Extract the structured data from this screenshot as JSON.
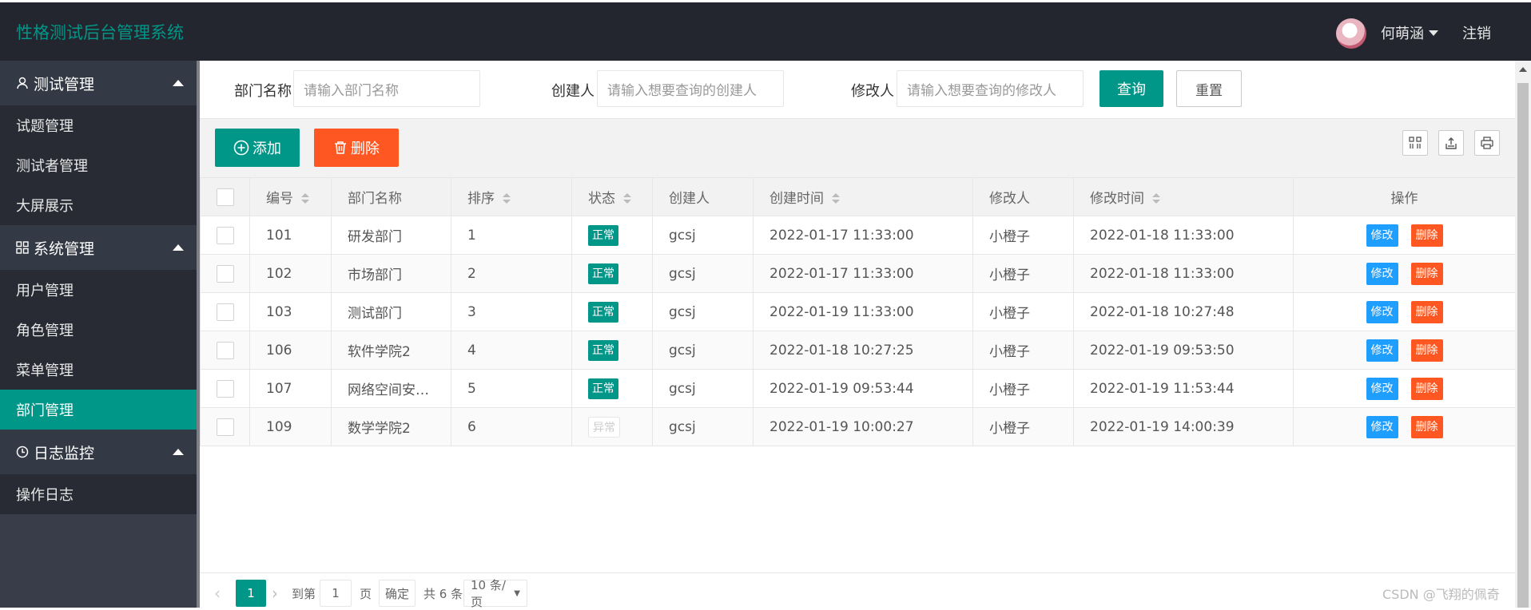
{
  "header": {
    "title": "性格测试后台管理系统",
    "username": "何萌涵",
    "logout": "注销"
  },
  "sidebar": {
    "groups": [
      {
        "label": "测试管理",
        "items": [
          "试题管理",
          "测试者管理",
          "大屏展示"
        ]
      },
      {
        "label": "系统管理",
        "items": [
          "用户管理",
          "角色管理",
          "菜单管理",
          "部门管理"
        ]
      },
      {
        "label": "日志监控",
        "items": [
          "操作日志"
        ]
      }
    ],
    "active_item": "部门管理"
  },
  "search": {
    "dept_label": "部门名称",
    "dept_placeholder": "请输入部门名称",
    "creator_label": "创建人",
    "creator_placeholder": "请输入想要查询的创建人",
    "modifier_label": "修改人",
    "modifier_placeholder": "请输入想要查询的修改人",
    "query": "查询",
    "reset": "重置"
  },
  "toolbar": {
    "add": "添加",
    "delete": "删除"
  },
  "table": {
    "headers": [
      "编号",
      "部门名称",
      "排序",
      "状态",
      "创建人",
      "创建时间",
      "修改人",
      "修改时间",
      "操作"
    ],
    "rows": [
      {
        "id": "101",
        "name": "研发部门",
        "order": "1",
        "status": "正常",
        "creator": "gcsj",
        "created": "2022-01-17 11:33:00",
        "modifier": "小橙子",
        "modified": "2022-01-18 11:33:00"
      },
      {
        "id": "102",
        "name": "市场部门",
        "order": "2",
        "status": "正常",
        "creator": "gcsj",
        "created": "2022-01-17 11:33:00",
        "modifier": "小橙子",
        "modified": "2022-01-18 11:33:00"
      },
      {
        "id": "103",
        "name": "测试部门",
        "order": "3",
        "status": "正常",
        "creator": "gcsj",
        "created": "2022-01-19 11:33:00",
        "modifier": "小橙子",
        "modified": "2022-01-18 10:27:48"
      },
      {
        "id": "106",
        "name": "软件学院2",
        "order": "4",
        "status": "正常",
        "creator": "gcsj",
        "created": "2022-01-18 10:27:25",
        "modifier": "小橙子",
        "modified": "2022-01-19 09:53:50"
      },
      {
        "id": "107",
        "name": "网络空间安…",
        "order": "5",
        "status": "正常",
        "creator": "gcsj",
        "created": "2022-01-19 09:53:44",
        "modifier": "小橙子",
        "modified": "2022-01-19 11:53:44"
      },
      {
        "id": "109",
        "name": "数学学院2",
        "order": "6",
        "status": "异常",
        "creator": "gcsj",
        "created": "2022-01-19 10:00:27",
        "modifier": "小橙子",
        "modified": "2022-01-19 14:00:39"
      }
    ],
    "edit_label": "修改",
    "delete_label": "删除"
  },
  "pager": {
    "current": "1",
    "goto_label": "到第",
    "page_input": "1",
    "page_label": "页",
    "confirm": "确定",
    "total": "共 6 条",
    "page_size": "10 条/页"
  },
  "watermark": "CSDN @飞翔的佩奇"
}
